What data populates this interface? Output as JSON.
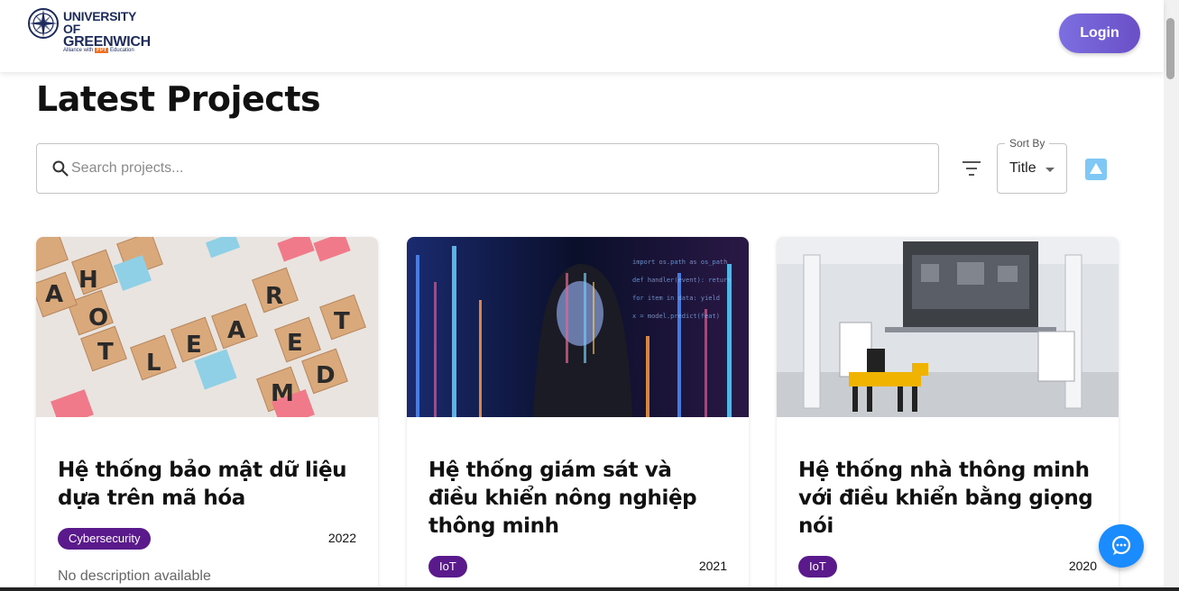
{
  "header": {
    "logo_line1": "UNIVERSITY OF",
    "logo_line2": "GREENWICH",
    "logo_alliance": "Alliance with",
    "logo_fpt": "FPT",
    "logo_education": "Education",
    "login_label": "Login"
  },
  "main": {
    "title": "Latest Projects",
    "search": {
      "placeholder": "Search projects..."
    },
    "sort": {
      "legend": "Sort By",
      "value": "Title"
    }
  },
  "projects": [
    {
      "title": "Hệ thống bảo mật dữ liệu dựa trên mã hóa",
      "tag": "Cybersecurity",
      "year": "2022",
      "description": "No description available"
    },
    {
      "title": "Hệ thống giám sát và điều khiển nông nghiệp thông minh",
      "tag": "IoT",
      "year": "2021",
      "description": ""
    },
    {
      "title": "Hệ thống nhà thông minh với điều khiển bằng giọng nói",
      "tag": "IoT",
      "year": "2020",
      "description": ""
    }
  ],
  "colors": {
    "login_gradient_start": "#7c6fe0",
    "login_gradient_end": "#6a4fc7",
    "tag_bg": "#5b1a8c",
    "chat_button": "#1a8cff",
    "sort_order_button": "#7fc8f5"
  },
  "icons": {
    "search": "search-icon",
    "filter": "filter-icon",
    "sort_order": "sort-ascending-icon",
    "chat": "chat-icon"
  }
}
